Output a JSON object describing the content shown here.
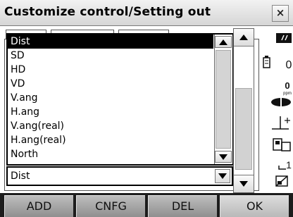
{
  "window": {
    "title": "Customize control/Setting out",
    "close_label": "×"
  },
  "dropdown": {
    "items": [
      {
        "label": "Dist",
        "selected": true
      },
      {
        "label": "SD",
        "selected": false
      },
      {
        "label": "HD",
        "selected": false
      },
      {
        "label": "VD",
        "selected": false
      },
      {
        "label": "V.ang",
        "selected": false
      },
      {
        "label": "H.ang",
        "selected": false
      },
      {
        "label": "V.ang(real)",
        "selected": false
      },
      {
        "label": "H.ang(real)",
        "selected": false
      },
      {
        "label": "North",
        "selected": false
      }
    ],
    "current_value": "Dist"
  },
  "status_panel": {
    "items": [
      {
        "icon": "signal-icon"
      },
      {
        "icon": "battery-icon",
        "value": "0"
      },
      {
        "icon": "ppm-icon",
        "value": "0",
        "unit": "ppm"
      },
      {
        "icon": "target-icon"
      },
      {
        "icon": "tilt-icon"
      },
      {
        "icon": "instrument-icon"
      },
      {
        "icon": "input-mode-icon",
        "value": "1"
      },
      {
        "icon": "memory-card-icon"
      }
    ]
  },
  "softkeys": [
    {
      "label": "ADD"
    },
    {
      "label": "CNFG"
    },
    {
      "label": "DEL"
    },
    {
      "label": "OK"
    }
  ]
}
